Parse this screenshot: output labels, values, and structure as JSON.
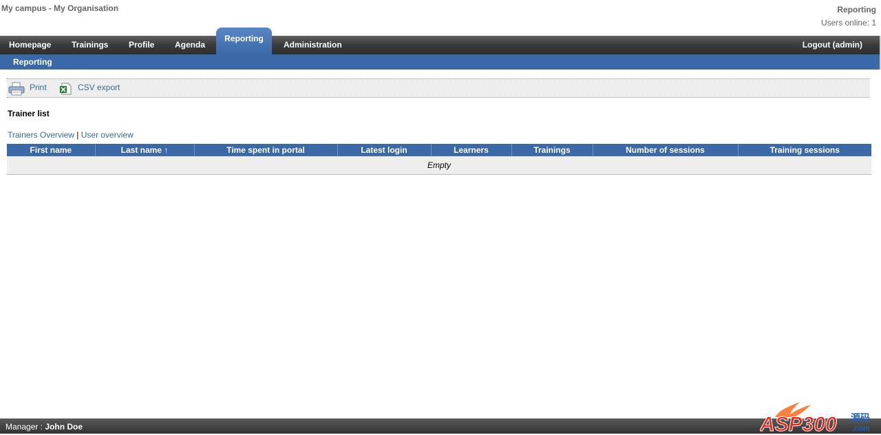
{
  "header": {
    "site_title": "My campus - My Organisation",
    "current_section": "Reporting",
    "users_online": "Users online: 1"
  },
  "nav": {
    "items": [
      {
        "label": "Homepage"
      },
      {
        "label": "Trainings"
      },
      {
        "label": "Profile"
      },
      {
        "label": "Agenda"
      },
      {
        "label": "Reporting"
      },
      {
        "label": "Administration"
      }
    ],
    "active": "Reporting",
    "logout": "Logout (admin)"
  },
  "subnav": {
    "items": [
      {
        "label": "Reporting"
      }
    ]
  },
  "toolbar": {
    "print_label": "Print",
    "csv_label": "CSV export"
  },
  "section_title": "Trainer list",
  "view_links": {
    "trainers_overview": "Trainers Overview",
    "separator": "|",
    "user_overview": "User overview"
  },
  "table": {
    "columns": [
      "First name",
      "Last name ↑",
      "Time spent in portal",
      "Latest login",
      "Learners",
      "Trainings",
      "Number of sessions",
      "Training sessions"
    ],
    "empty_text": "Empty"
  },
  "footer": {
    "manager_label": "Manager :",
    "manager_name": "John Doe"
  },
  "watermark": {
    "text": "ASP300",
    "cn": "源码",
    "domain": ".com"
  },
  "colors": {
    "nav_dark": "#3a3a3a",
    "accent_blue": "#3b69a8",
    "link_blue": "#3b6aa0"
  }
}
